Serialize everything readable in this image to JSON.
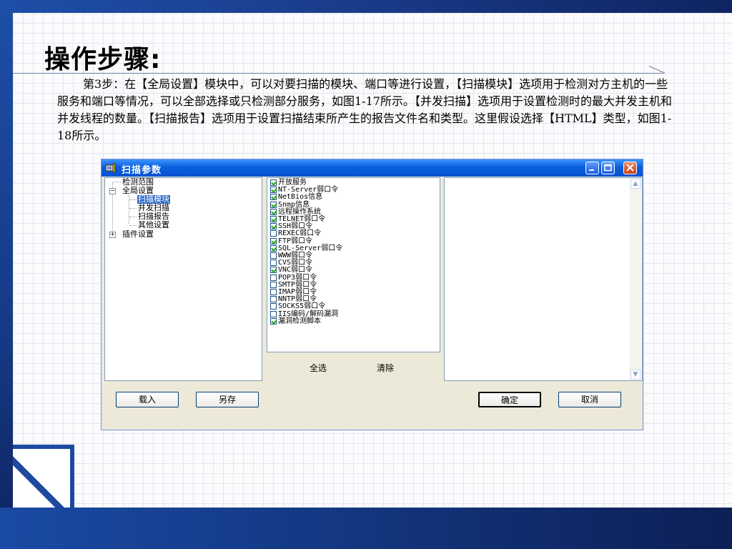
{
  "slide": {
    "title": "操作步骤:",
    "body_text": "第3步：在【全局设置】模块中，可以对要扫描的模块、端口等进行设置，【扫描模块】选项用于检测对方主机的一些服务和端口等情况，可以全部选择或只检测部分服务，如图1-17所示。【并发扫描】选项用于设置检测时的最大并发主机和并发线程的数量。【扫描报告】选项用于设置扫描结束所产生的报告文件名和类型。这里假设选择【HTML】类型，如图1-18所示。"
  },
  "dialog": {
    "title": "扫描参数",
    "tree": [
      {
        "label": "检测范围",
        "expander": "",
        "selected": false
      },
      {
        "label": "全局设置",
        "expander": "−",
        "selected": false
      },
      {
        "label": "扫描模块",
        "expander": "",
        "selected": true
      },
      {
        "label": "并发扫描",
        "expander": "",
        "selected": false
      },
      {
        "label": "扫描报告",
        "expander": "",
        "selected": false
      },
      {
        "label": "其他设置",
        "expander": "",
        "selected": false
      },
      {
        "label": "插件设置",
        "expander": "+",
        "selected": false
      }
    ],
    "modules": [
      {
        "label": "开放服务",
        "checked": true
      },
      {
        "label": "NT-Server弱口令",
        "checked": true
      },
      {
        "label": "NetBios信息",
        "checked": true
      },
      {
        "label": "Snmp信息",
        "checked": true
      },
      {
        "label": "远程操作系统",
        "checked": true
      },
      {
        "label": "TELNET弱口令",
        "checked": true
      },
      {
        "label": "SSH弱口令",
        "checked": true
      },
      {
        "label": "REXEC弱口令",
        "checked": false
      },
      {
        "label": "FTP弱口令",
        "checked": true
      },
      {
        "label": "SQL-Server弱口令",
        "checked": true
      },
      {
        "label": "WWW弱口令",
        "checked": false
      },
      {
        "label": "CVS弱口令",
        "checked": false
      },
      {
        "label": "VNC弱口令",
        "checked": true
      },
      {
        "label": "POP3弱口令",
        "checked": false
      },
      {
        "label": "SMTP弱口令",
        "checked": false
      },
      {
        "label": "IMAP弱口令",
        "checked": false
      },
      {
        "label": "NNTP弱口令",
        "checked": false
      },
      {
        "label": "SOCKS5弱口令",
        "checked": false
      },
      {
        "label": "IIS编码/解码漏洞",
        "checked": false
      },
      {
        "label": "漏洞检测脚本",
        "checked": true
      }
    ],
    "select_all_label": "全选",
    "clear_label": "清除",
    "load_label": "载入",
    "save_as_label": "另存",
    "ok_label": "确定",
    "cancel_label": "取消"
  }
}
